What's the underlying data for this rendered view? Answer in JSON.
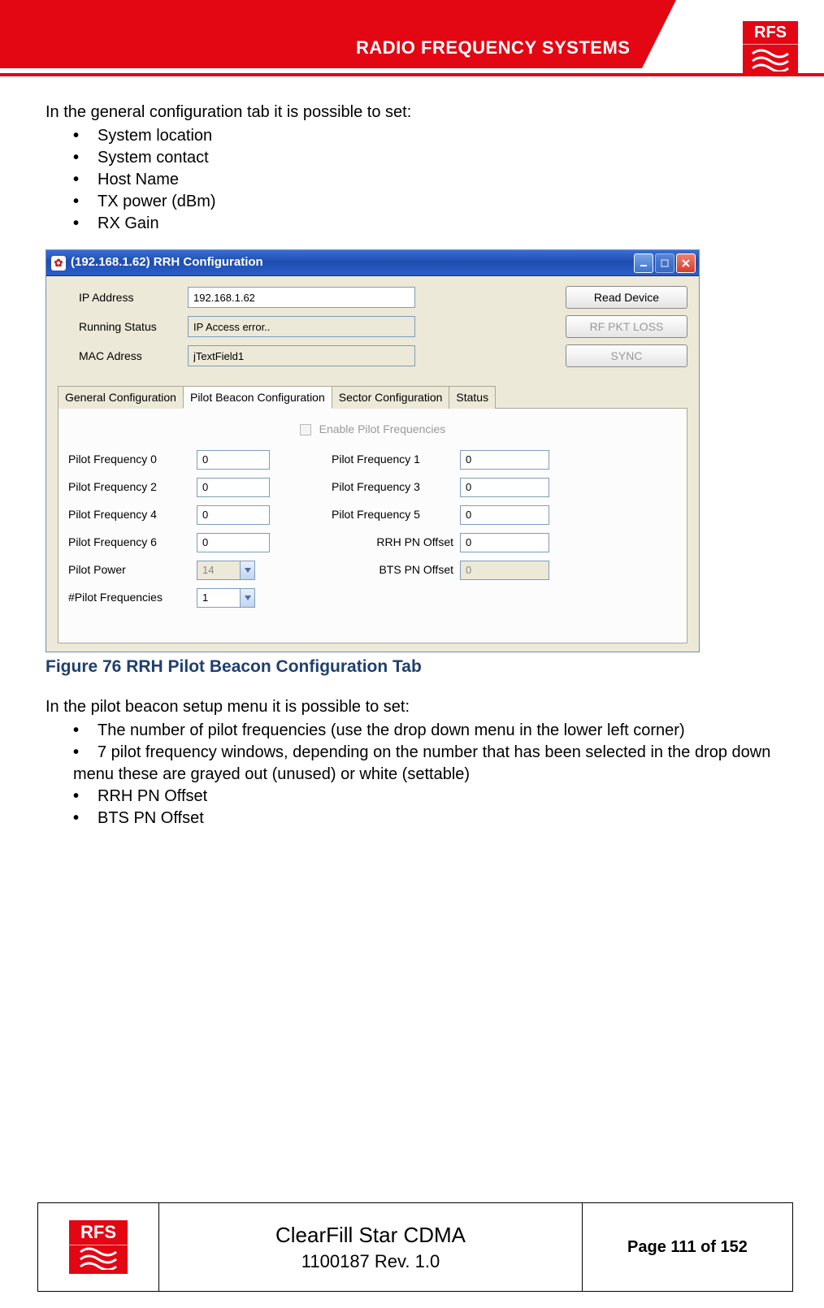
{
  "header": {
    "brand_text": "RADIO FREQUENCY SYSTEMS",
    "logo_initials": "RFS"
  },
  "intro": {
    "line": "In the general configuration tab it is possible to set:",
    "bullets": [
      "System location",
      "System contact",
      "Host Name",
      "TX power (dBm)",
      "RX Gain"
    ]
  },
  "window": {
    "title": "(192.168.1.62) RRH Configuration",
    "fields": {
      "ip_label": "IP Address",
      "ip_value": "192.168.1.62",
      "status_label": "Running Status",
      "status_value": "IP Access error..",
      "mac_label": "MAC Adress",
      "mac_value": "jTextField1",
      "read_btn": "Read Device",
      "rf_btn": "RF PKT LOSS",
      "sync_btn": "SYNC"
    },
    "tabs": [
      "General Configuration",
      "Pilot Beacon Configuration",
      "Sector Configuration",
      "Status"
    ],
    "enable_label": "Enable Pilot Frequencies",
    "freq": {
      "pf0_l": "Pilot Frequency 0",
      "pf0_v": "0",
      "pf1_l": "Pilot Frequency 1",
      "pf1_v": "0",
      "pf2_l": "Pilot Frequency 2",
      "pf2_v": "0",
      "pf3_l": "Pilot Frequency 3",
      "pf3_v": "0",
      "pf4_l": "Pilot Frequency 4",
      "pf4_v": "0",
      "pf5_l": "Pilot Frequency 5",
      "pf5_v": "0",
      "pf6_l": "Pilot Frequency 6",
      "pf6_v": "0",
      "rrh_l": "RRH PN Offset",
      "rrh_v": "0",
      "pp_l": "Pilot Power",
      "pp_v": "14",
      "bts_l": "BTS PN Offset",
      "bts_v": "0",
      "nf_l": "#Pilot Frequencies",
      "nf_v": "1"
    }
  },
  "figure_caption": "Figure 76 RRH Pilot Beacon Configuration Tab",
  "after": {
    "line": "In the pilot beacon setup menu it is possible to set:",
    "bullets": [
      "The number of pilot frequencies (use the drop down menu in the lower left corner)",
      "7 pilot frequency windows, depending on the number that has been selected in the drop down menu these are grayed out (unused) or white (settable)",
      "RRH PN Offset",
      "BTS PN Offset"
    ]
  },
  "footer": {
    "logo_initials": "RFS",
    "product": "ClearFill Star CDMA",
    "rev": "1100187 Rev. 1.0",
    "page": "Page 111 of 152"
  }
}
